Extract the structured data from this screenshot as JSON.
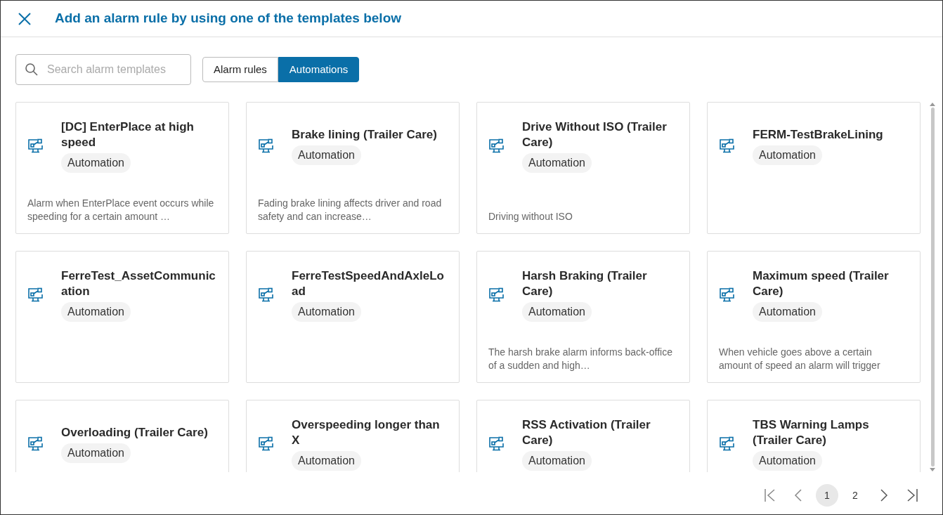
{
  "header": {
    "title": "Add an alarm rule by using one of the templates below"
  },
  "search": {
    "placeholder": "Search alarm templates"
  },
  "tabs": [
    {
      "label": "Alarm rules",
      "selected": false
    },
    {
      "label": "Automations",
      "selected": true
    }
  ],
  "templates": [
    {
      "name": "[DC] EnterPlace at high speed",
      "tag": "Automation",
      "description": "Alarm when EnterPlace event occurs while speeding for a certain amount …"
    },
    {
      "name": "Brake lining (Trailer Care)",
      "tag": "Automation",
      "description": "Fading brake lining affects driver and road safety and can increase…"
    },
    {
      "name": "Drive Without ISO (Trailer Care)",
      "tag": "Automation",
      "description": "Driving without ISO"
    },
    {
      "name": "FERM-TestBrakeLining",
      "tag": "Automation"
    },
    {
      "name": "FerreTest_AssetCommunication",
      "tag": "Automation"
    },
    {
      "name": "FerreTestSpeedAndAxleLoad",
      "tag": "Automation"
    },
    {
      "name": "Harsh Braking (Trailer Care)",
      "tag": "Automation",
      "description": "The harsh brake alarm informs back-office of a sudden and high…"
    },
    {
      "name": "Maximum speed (Trailer Care)",
      "tag": "Automation",
      "description": "When vehicle goes above a certain amount of speed an alarm will trigger"
    },
    {
      "name": "Overloading (Trailer Care)",
      "tag": "Automation"
    },
    {
      "name": "Overspeeding longer than X",
      "tag": "Automation"
    },
    {
      "name": "RSS Activation (Trailer Care)",
      "tag": "Automation"
    },
    {
      "name": "TBS Warning Lamps (Trailer Care)",
      "tag": "Automation"
    }
  ],
  "pagination": {
    "pages": [
      {
        "label": "1",
        "selected": true
      },
      {
        "label": "2",
        "selected": false
      }
    ]
  }
}
